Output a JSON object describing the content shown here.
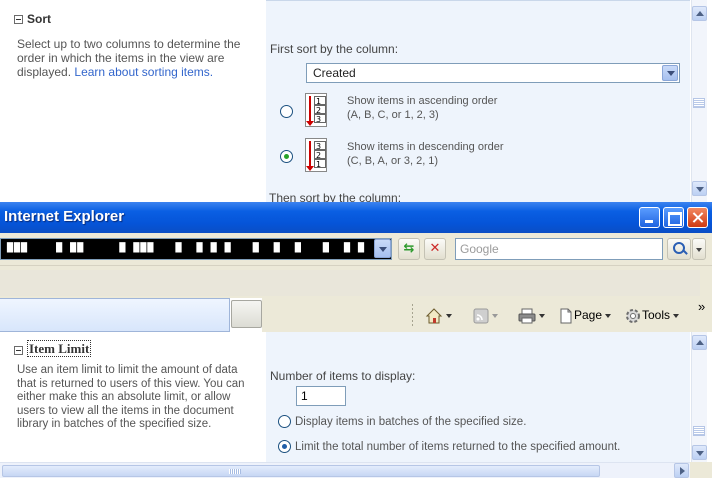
{
  "sort_section": {
    "title": "Sort",
    "description": "Select up to two columns to determine the order in which the items in the view are displayed.",
    "link_text": "Learn about sorting items.",
    "first_sort_label": "First sort by the column:",
    "first_sort_value": "Created",
    "options": [
      {
        "label_line1": "Show items in ascending order",
        "label_line2": "(A, B, C, or 1, 2, 3)",
        "selected": false,
        "icon": "sort-ascending-icon"
      },
      {
        "label_line1": "Show items in descending order",
        "label_line2": "(C, B, A, or 3, 2, 1)",
        "selected": true,
        "icon": "sort-descending-icon"
      }
    ],
    "then_sort_label": "Then sort by the column:"
  },
  "browser": {
    "title": "Internet Explorer",
    "address_text": "▇▇▇    ▇ ▇▇     ▇ ▇▇▇   ▇  ▇ ▇ ▇   ▇  ▇  ▇   ▇  ▇ ▇  ▇",
    "search_placeholder": "Google",
    "commands": {
      "page": "Page",
      "tools": "Tools",
      "overflow": "»"
    }
  },
  "item_limit_section": {
    "title": "Item Limit",
    "description": "Use an item limit to limit the amount of data that is returned to users of this view. You can either make this an absolute limit, or allow users to view all the items in the document library in batches of the specified size.",
    "number_label": "Number of items to display:",
    "number_value": "1",
    "options": [
      {
        "label": "Display items in batches of the specified size.",
        "selected": false
      },
      {
        "label": "Limit the total number of items returned to the specified amount.",
        "selected": true
      }
    ]
  },
  "colors": {
    "titlebar": "#0554d8",
    "panel_bg": "#eef4fc",
    "link": "#3366cc",
    "radio_green": "#29a329"
  }
}
